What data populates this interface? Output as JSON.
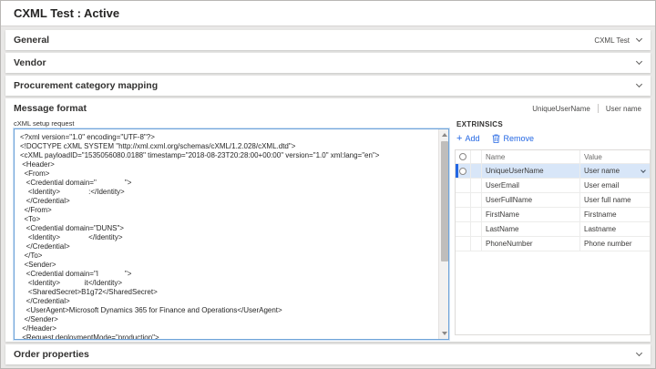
{
  "title": "CXML Test : Active",
  "sections": {
    "general": {
      "label": "General",
      "summary": "CXML Test"
    },
    "vendor": {
      "label": "Vendor"
    },
    "procurement": {
      "label": "Procurement category mapping"
    },
    "message_format": {
      "label": "Message format",
      "summary_fields": [
        "UniqueUserName",
        "User name"
      ],
      "request_label": "cXML setup request",
      "request_xml": "<?xml version=\"1.0\" encoding=\"UTF-8\"?>\n<!DOCTYPE cXML SYSTEM \"http://xml.cxml.org/schemas/cXML/1.2.028/cXML.dtd\">\n<cXML payloadID=\"1535056080.0188\" timestamp=\"2018-08-23T20:28:00+00:00\" version=\"1.0\" xml:lang=\"en\">\n <Header>\n  <From>\n   <Credential domain=\"              \">\n    <Identity>              :</Identity>\n   </Credential>\n  </From>\n  <To>\n   <Credential domain=\"DUNS\">\n    <Identity>              </Identity>\n   </Credential>\n  </To>\n  <Sender>\n   <Credential domain=\"I             \">\n    <Identity>            it</Identity>\n    <SharedSecret>B1g72</SharedSecret>\n   </Credential>\n   <UserAgent>Microsoft Dynamics 365 for Finance and Operations</UserAgent>\n  </Sender>\n </Header>\n <Request deploymentMode=\"production\">",
      "extrinsics": {
        "title": "EXTRINSICS",
        "add_label": "Add",
        "remove_label": "Remove",
        "columns": {
          "name": "Name",
          "value": "Value"
        },
        "rows": [
          {
            "name": "UniqueUserName",
            "value": "User name",
            "selected": true
          },
          {
            "name": "UserEmail",
            "value": "User email",
            "selected": false
          },
          {
            "name": "UserFullName",
            "value": "User full name",
            "selected": false
          },
          {
            "name": "FirstName",
            "value": "Firstname",
            "selected": false
          },
          {
            "name": "LastName",
            "value": "Lastname",
            "selected": false
          },
          {
            "name": "PhoneNumber",
            "value": "Phone number",
            "selected": false
          }
        ]
      }
    },
    "order_properties": {
      "label": "Order properties"
    }
  },
  "icons": {
    "add": "+",
    "remove": "trash-can",
    "expand": "chevron-down",
    "row_select": "radio-circle"
  },
  "colors": {
    "accent": "#2266E3",
    "selected_row_bg": "#d8e6f8",
    "card_bg": "#ffffff",
    "page_bg": "#e9e8e7"
  }
}
